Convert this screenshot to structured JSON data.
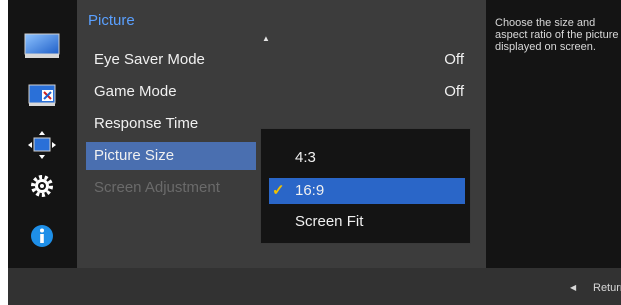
{
  "menu": {
    "title": "Picture",
    "items": [
      {
        "label": "Eye Saver Mode",
        "value": "Off"
      },
      {
        "label": "Game Mode",
        "value": "Off"
      },
      {
        "label": "Response Time",
        "value": ""
      },
      {
        "label": "Picture Size",
        "value": ""
      },
      {
        "label": "Screen Adjustment",
        "value": ""
      }
    ]
  },
  "submenu": {
    "options": [
      "4:3",
      "16:9",
      "Screen Fit"
    ],
    "selected": "16:9"
  },
  "help": {
    "text": "Choose the size and aspect ratio of the picture displayed on screen."
  },
  "footer": {
    "return_label": "Return"
  },
  "icons": [
    "picture-icon",
    "pip-icon",
    "move-icon",
    "settings-icon",
    "info-icon"
  ],
  "colors": {
    "title": "#5aa0ff",
    "selected_row": "#4a6fb0",
    "selected_option": "#2a66c8",
    "checkmark": "#f2c200"
  }
}
